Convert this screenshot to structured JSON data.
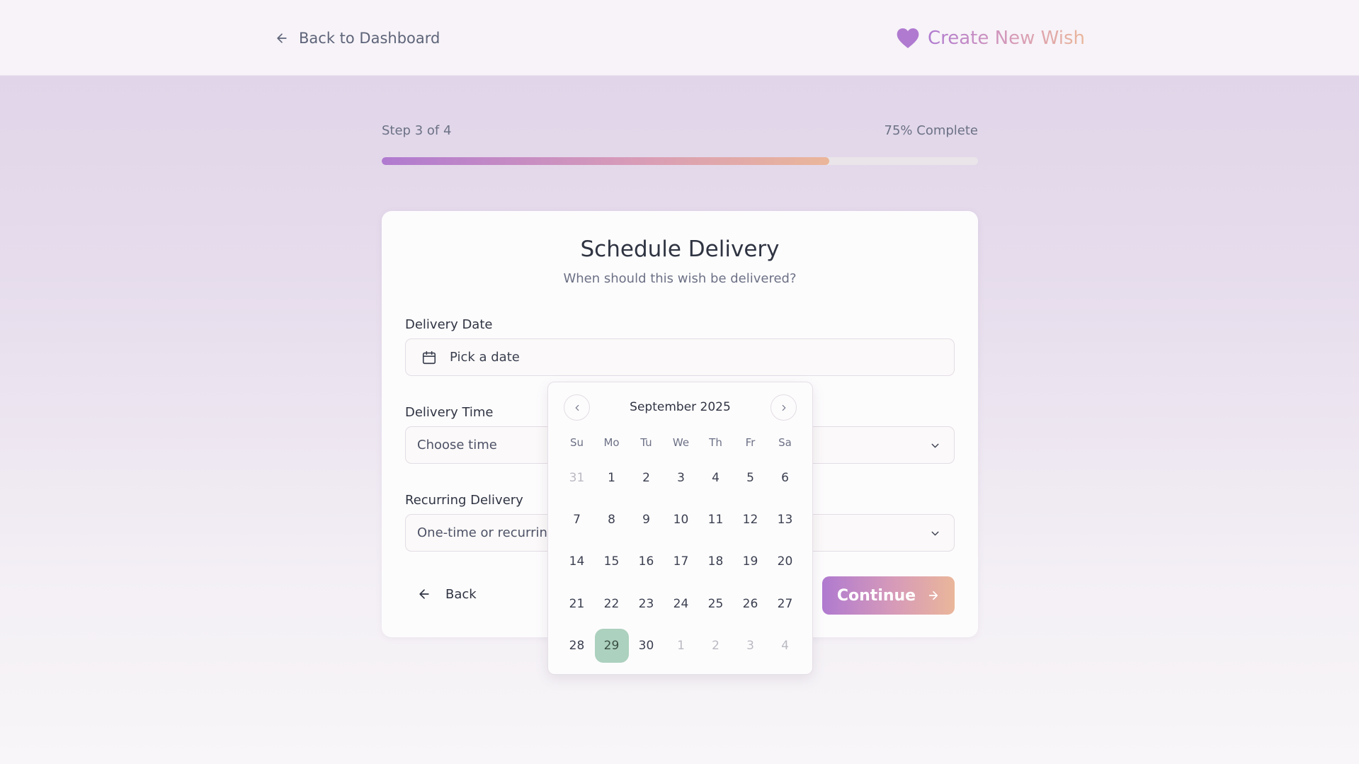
{
  "header": {
    "back_label": "Back to Dashboard",
    "brand_title": "Create New Wish",
    "brand_icon": "heart-icon"
  },
  "progress": {
    "step_text": "Step 3 of 4",
    "percent_text": "75% Complete",
    "percent": 75
  },
  "card": {
    "title": "Schedule Delivery",
    "subtitle": "When should this wish be delivered?",
    "delivery_date": {
      "label": "Delivery Date",
      "placeholder": "Pick a date",
      "icon": "calendar-icon"
    },
    "delivery_time": {
      "label": "Delivery Time",
      "placeholder": "Choose time"
    },
    "recurring": {
      "label": "Recurring Delivery",
      "placeholder": "One-time or recurring"
    },
    "back_button": "Back",
    "continue_button": "Continue"
  },
  "calendar": {
    "month_label": "September 2025",
    "weekdays": [
      "Su",
      "Mo",
      "Tu",
      "We",
      "Th",
      "Fr",
      "Sa"
    ],
    "selected_day": "29",
    "days": [
      {
        "d": "31",
        "muted": true
      },
      {
        "d": "1"
      },
      {
        "d": "2"
      },
      {
        "d": "3"
      },
      {
        "d": "4"
      },
      {
        "d": "5"
      },
      {
        "d": "6"
      },
      {
        "d": "7"
      },
      {
        "d": "8"
      },
      {
        "d": "9"
      },
      {
        "d": "10"
      },
      {
        "d": "11"
      },
      {
        "d": "12"
      },
      {
        "d": "13"
      },
      {
        "d": "14"
      },
      {
        "d": "15"
      },
      {
        "d": "16"
      },
      {
        "d": "17"
      },
      {
        "d": "18"
      },
      {
        "d": "19"
      },
      {
        "d": "20"
      },
      {
        "d": "21"
      },
      {
        "d": "22"
      },
      {
        "d": "23"
      },
      {
        "d": "24"
      },
      {
        "d": "25"
      },
      {
        "d": "26"
      },
      {
        "d": "27"
      },
      {
        "d": "28"
      },
      {
        "d": "29",
        "selected": true
      },
      {
        "d": "30"
      },
      {
        "d": "1",
        "muted": true
      },
      {
        "d": "2",
        "muted": true
      },
      {
        "d": "3",
        "muted": true
      },
      {
        "d": "4",
        "muted": true
      }
    ]
  },
  "colors": {
    "accent_start": "#b07ad0",
    "accent_end": "#eab69a",
    "selected_day_bg": "#acd1be"
  }
}
